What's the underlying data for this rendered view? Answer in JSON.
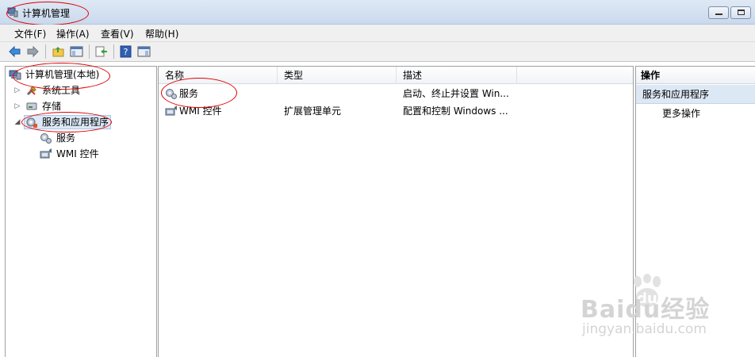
{
  "window": {
    "title": "计算机管理"
  },
  "menu": {
    "items": [
      "文件(F)",
      "操作(A)",
      "查看(V)",
      "帮助(H)"
    ]
  },
  "tree": {
    "root": "计算机管理(本地)",
    "items": [
      {
        "label": "系统工具",
        "expander": "▷",
        "icon": "tools-icon"
      },
      {
        "label": "存储",
        "expander": "▷",
        "icon": "storage-icon"
      },
      {
        "label": "服务和应用程序",
        "expander": "◢",
        "icon": "services-apps-icon"
      }
    ],
    "children": [
      {
        "label": "服务",
        "icon": "services-gear-icon"
      },
      {
        "label": "WMI 控件",
        "icon": "wmi-icon"
      }
    ]
  },
  "list": {
    "columns": [
      "名称",
      "类型",
      "描述"
    ],
    "rows": [
      {
        "name": "服务",
        "type": "",
        "desc": "启动、终止并设置 Win..."
      },
      {
        "name": "WMI 控件",
        "type": "扩展管理单元",
        "desc": "配置和控制 Windows ..."
      }
    ]
  },
  "actions": {
    "header": "操作",
    "section": "服务和应用程序",
    "more": "更多操作"
  },
  "watermark": {
    "logo": "Baidu经验",
    "url": "jingyan.baidu.com"
  },
  "colors": {
    "accent_red": "#e00000",
    "selected_bg": "#dce9f7",
    "section_bg": "#dde8f5"
  }
}
